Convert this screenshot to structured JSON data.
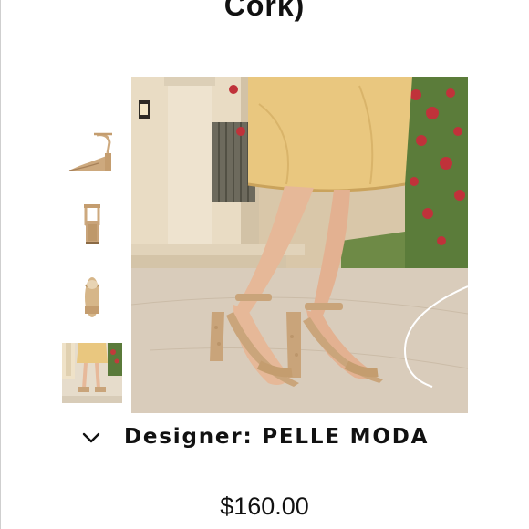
{
  "product": {
    "title_fragment": "Cork)",
    "designer_label": "Designer: PELLE MODA",
    "price": "$160.00"
  },
  "gallery": {
    "thumbnails": [
      {
        "name": "side-view"
      },
      {
        "name": "back-view"
      },
      {
        "name": "top-view"
      },
      {
        "name": "on-model-view"
      }
    ],
    "selected_index": 3
  },
  "icons": {
    "expand": "chevron-down-icon"
  },
  "colors": {
    "text": "#111111",
    "divider": "#dcdcdc",
    "cork": "#c9a47a",
    "skirt": "#e9c77f"
  }
}
